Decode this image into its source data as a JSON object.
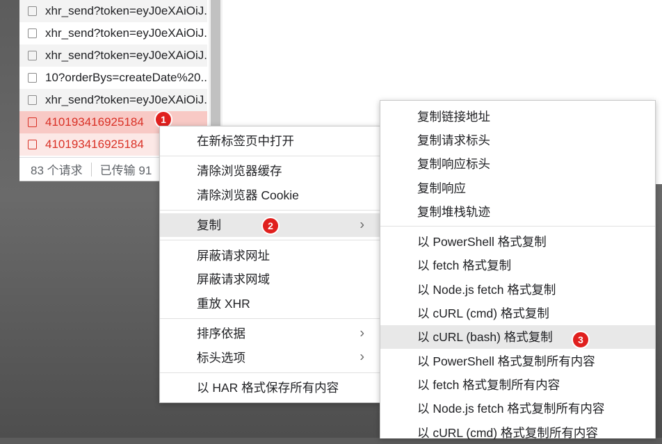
{
  "requests": [
    {
      "name": "xhr_send?token=eyJ0eXAiOiJ..",
      "error": false
    },
    {
      "name": "xhr_send?token=eyJ0eXAiOiJ..",
      "error": false
    },
    {
      "name": "xhr_send?token=eyJ0eXAiOiJ..",
      "error": false
    },
    {
      "name": "10?orderBys=createDate%20..",
      "error": false
    },
    {
      "name": "xhr_send?token=eyJ0eXAiOiJ..",
      "error": false
    },
    {
      "name": "410193416925184",
      "error": true,
      "selected": true
    },
    {
      "name": "410193416925184",
      "error": true
    }
  ],
  "status": {
    "count": "83 个请求",
    "transferred": "已传输 91"
  },
  "context_menu": {
    "open_new_tab": "在新标签页中打开",
    "clear_cache": "清除浏览器缓存",
    "clear_cookie": "清除浏览器 Cookie",
    "copy": "复制",
    "block_url": "屏蔽请求网址",
    "block_domain": "屏蔽请求网域",
    "replay_xhr": "重放 XHR",
    "sort_by": "排序依据",
    "header_options": "标头选项",
    "save_har": "以 HAR 格式保存所有内容"
  },
  "copy_submenu": {
    "copy_link": "复制链接地址",
    "copy_request_headers": "复制请求标头",
    "copy_response_headers": "复制响应标头",
    "copy_response": "复制响应",
    "copy_stack_trace": "复制堆栈轨迹",
    "copy_powershell": "以 PowerShell 格式复制",
    "copy_fetch": "以 fetch 格式复制",
    "copy_nodejs_fetch": "以 Node.js fetch 格式复制",
    "copy_curl_cmd": "以 cURL (cmd) 格式复制",
    "copy_curl_bash": "以 cURL (bash) 格式复制",
    "copy_all_powershell": "以 PowerShell 格式复制所有内容",
    "copy_all_fetch": "以 fetch 格式复制所有内容",
    "copy_all_nodejs_fetch": "以 Node.js fetch 格式复制所有内容",
    "copy_all_curl_cmd": "以 cURL (cmd) 格式复制所有内容"
  },
  "badges": [
    "1",
    "2",
    "3"
  ],
  "colors": {
    "error_text": "#d93025",
    "badge": "#e0201e",
    "highlight": "#e8e8e8"
  },
  "icons": {
    "submenu_arrow": "chevron-right-icon",
    "row_checkbox": "checkbox-icon"
  }
}
